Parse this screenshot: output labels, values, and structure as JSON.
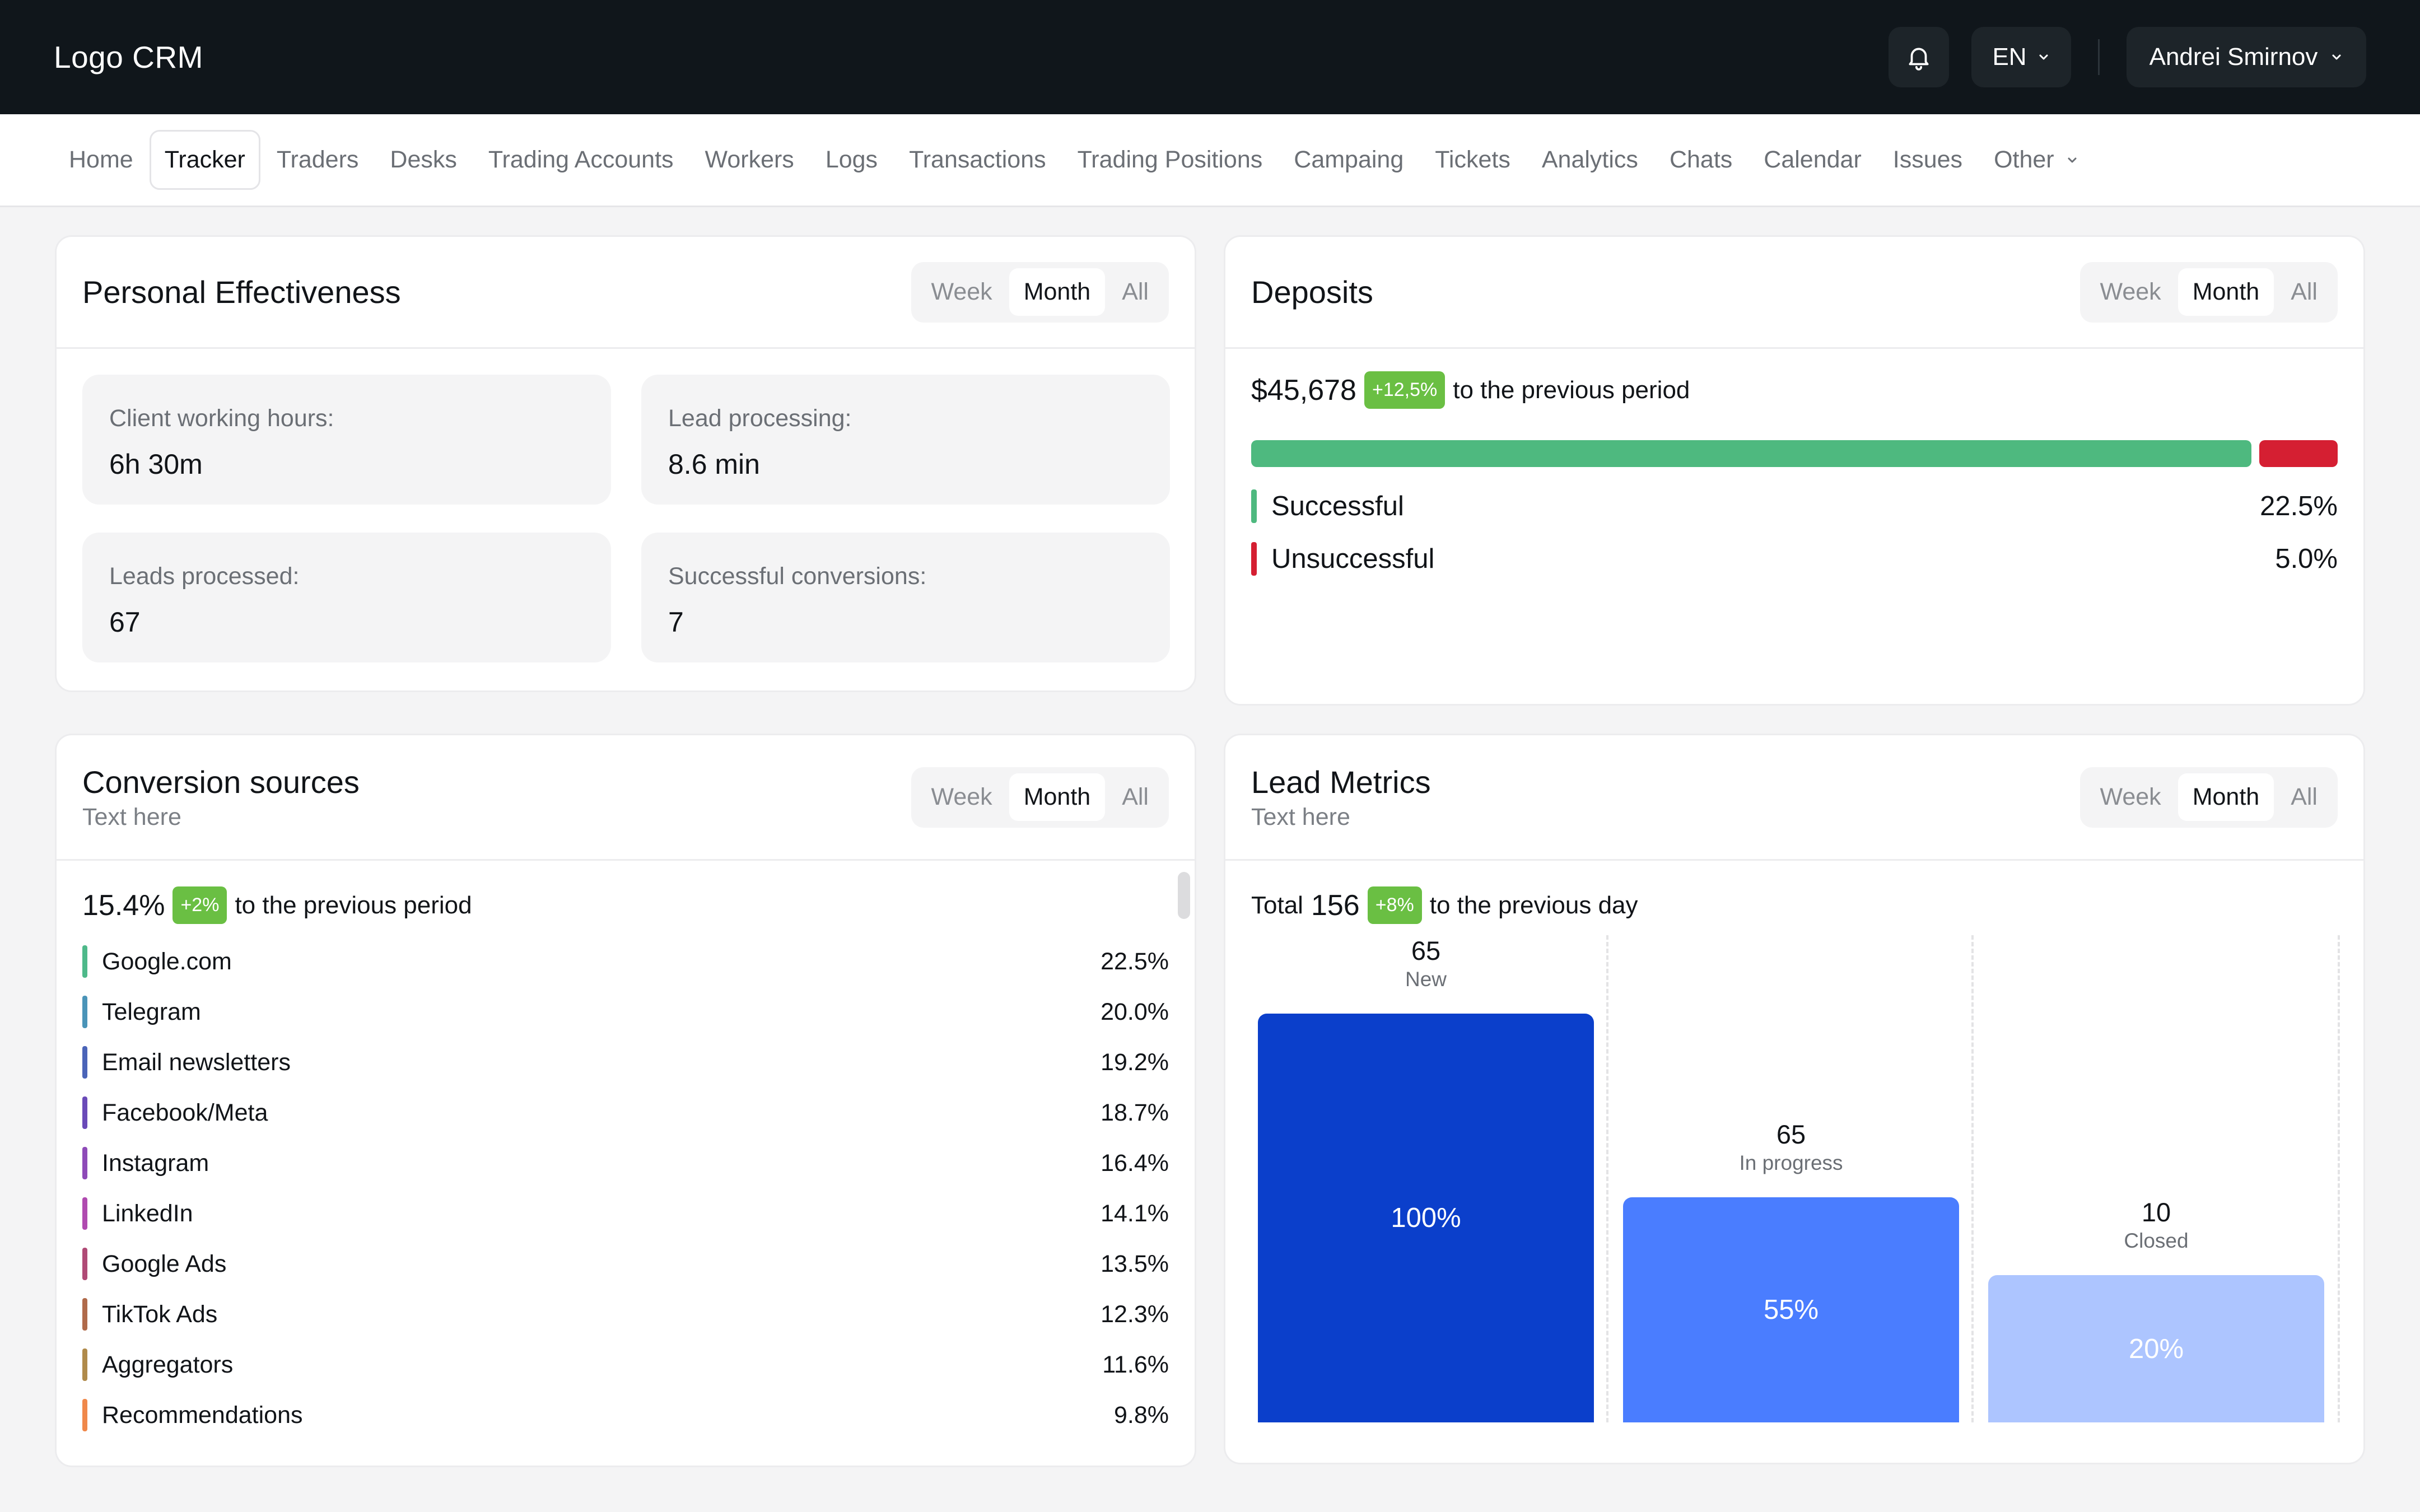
{
  "topbar": {
    "logo": "Logo CRM",
    "language": "EN",
    "user": "Andrei Smirnov"
  },
  "nav": {
    "items": [
      "Home",
      "Tracker",
      "Traders",
      "Desks",
      "Trading Accounts",
      "Workers",
      "Logs",
      "Transactions",
      "Trading Positions",
      "Campaing",
      "Tickets",
      "Analytics",
      "Chats",
      "Calendar",
      "Issues",
      "Other"
    ],
    "active": "Tracker"
  },
  "segment": {
    "week": "Week",
    "month": "Month",
    "all": "All",
    "selected": "Month"
  },
  "personal": {
    "title": "Personal Effectiveness",
    "stats": [
      {
        "label": "Client working hours:",
        "value": "6h 30m"
      },
      {
        "label": "Lead processing:",
        "value": "8.6 min"
      },
      {
        "label": "Leads processed:",
        "value": "67"
      },
      {
        "label": "Successful conversions:",
        "value": "7"
      }
    ]
  },
  "deposits": {
    "title": "Deposits",
    "amount": "$45,678",
    "change": "+12,5%",
    "compare_text": "to the previous period",
    "legend": [
      {
        "name": "Successful",
        "value": "22.5%",
        "color": "#4eb97f"
      },
      {
        "name": "Unsuccessful",
        "value": "5.0%",
        "color": "#d51f32"
      }
    ]
  },
  "conversion": {
    "title": "Conversion sources",
    "subtitle": "Text here",
    "value": "15.4%",
    "change": "+2%",
    "compare_text": "to the previous period",
    "sources": [
      {
        "name": "Google.com",
        "value": "22.5%",
        "color": "#4eb98a"
      },
      {
        "name": "Telegram",
        "value": "20.0%",
        "color": "#4a94b8"
      },
      {
        "name": "Email newsletters",
        "value": "19.2%",
        "color": "#4a64b8"
      },
      {
        "name": "Facebook/Meta",
        "value": "18.7%",
        "color": "#6a4ab8"
      },
      {
        "name": "Instagram",
        "value": "16.4%",
        "color": "#8e4ab8"
      },
      {
        "name": "LinkedIn",
        "value": "14.1%",
        "color": "#b04ab0"
      },
      {
        "name": "Google Ads",
        "value": "13.5%",
        "color": "#b04a76"
      },
      {
        "name": "TikTok Ads",
        "value": "12.3%",
        "color": "#b06a4a"
      },
      {
        "name": "Aggregators",
        "value": "11.6%",
        "color": "#b08a4a"
      },
      {
        "name": "Recommendations",
        "value": "9.8%",
        "color": "#f0884a"
      }
    ]
  },
  "leads": {
    "title": "Lead Metrics",
    "subtitle": "Text here",
    "total_label": "Total",
    "total": "156",
    "change": "+8%",
    "compare_text": "to the previous day"
  },
  "chart_data": {
    "type": "bar",
    "categories": [
      "New",
      "In progress",
      "Closed"
    ],
    "values": [
      65,
      65,
      10
    ],
    "bar_labels": [
      "100%",
      "55%",
      "20%"
    ],
    "relative_height": [
      1.0,
      0.55,
      0.36
    ],
    "colors": [
      "#0b3fcb",
      "#4a7dff",
      "#adc5ff"
    ],
    "title": "",
    "xlabel": "",
    "ylabel": ""
  }
}
